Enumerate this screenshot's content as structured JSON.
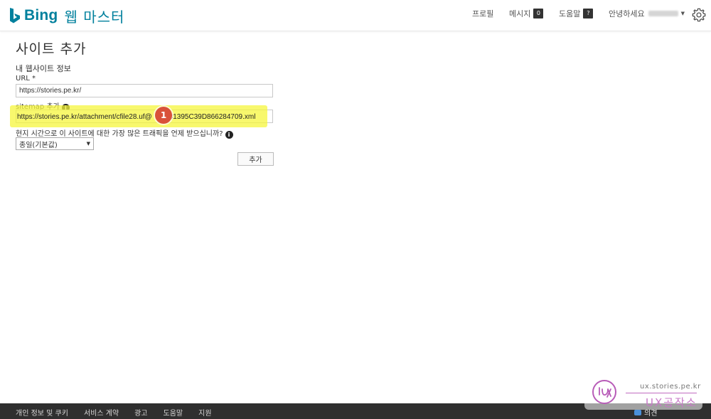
{
  "header": {
    "brand": "Bing",
    "product": "웹 마스터",
    "nav": {
      "profile": "프로필",
      "messages": "메시지",
      "messages_count": "0",
      "help": "도움말",
      "help_count": "?",
      "greeting": "안녕하세요"
    },
    "icons": {
      "logo": "bing-b-logo",
      "settings": "gear-icon",
      "dropdown": "caret-down-icon"
    }
  },
  "main": {
    "title": "사이트 추가",
    "section_title": "내 웹사이트 정보",
    "url_label": "URL *",
    "url_value": "https://stories.pe.kr/",
    "sitemap_label": "sitemap 추가",
    "sitemap_value_prefix": "https://stories.pe.kr/attachment/cfile28.uf@",
    "sitemap_value_suffix": "31395C39D866284709.xml",
    "traffic_question": "현지 시간으로 이 사이트에 대한 가장 많은 트래픽을 언제 받으십니까?",
    "traffic_selected": "종일(기본값)",
    "add_button": "추가",
    "step_marker": "1"
  },
  "footer": {
    "links": [
      "개인 정보 및 쿠키",
      "서비스 계약",
      "광고",
      "도움말",
      "지원"
    ],
    "feedback": "의견"
  },
  "watermark": {
    "url": "ux.stories.pe.kr",
    "name": "UX공작소"
  },
  "colors": {
    "brand": "#00809d",
    "highlight": "#f5f53c",
    "marker": "#d9523a",
    "footer": "#2f2f2f"
  }
}
